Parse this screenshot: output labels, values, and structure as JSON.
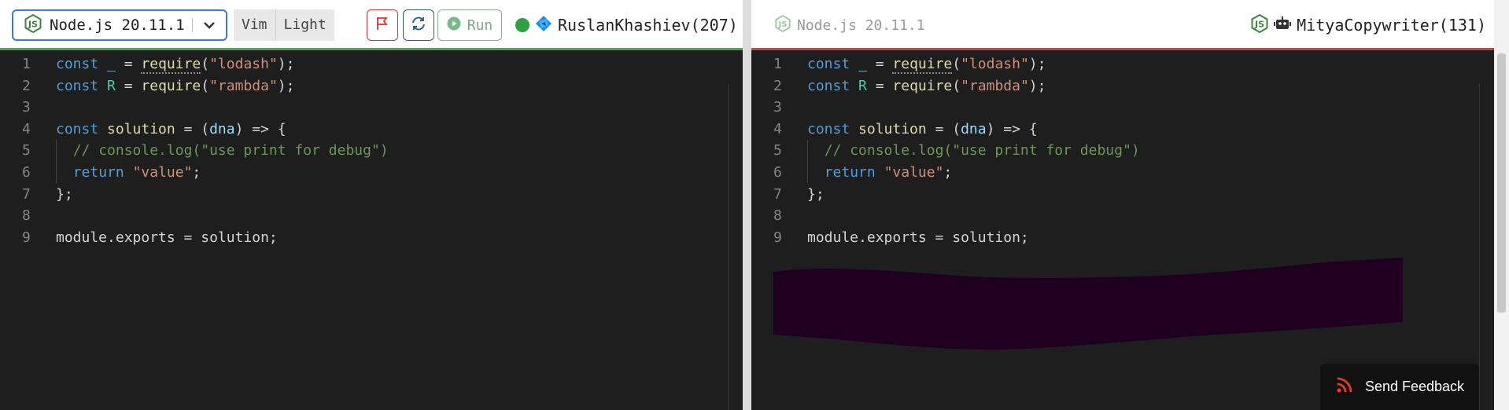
{
  "left": {
    "language_select": "Node.js 20.11.1",
    "mode_vim": "Vim",
    "mode_theme": "Light",
    "run_label": "Run",
    "player_name": "RuslanKhashiev(207)",
    "status_color": "#2ea043",
    "bar_color": "#3cb045"
  },
  "right": {
    "language": "Node.js 20.11.1",
    "player_name": "MityaCopywriter(131)",
    "bar_color": "#e03c3c"
  },
  "code_lines": [
    {
      "n": "1",
      "text": "const _ = require(\"lodash\");"
    },
    {
      "n": "2",
      "text": "const R = require(\"rambda\");"
    },
    {
      "n": "3",
      "text": ""
    },
    {
      "n": "4",
      "text": "const solution = (dna) => {"
    },
    {
      "n": "5",
      "text": "  // console.log(\"use print for debug\")"
    },
    {
      "n": "6",
      "text": "  return \"value\";"
    },
    {
      "n": "7",
      "text": "};"
    },
    {
      "n": "8",
      "text": ""
    },
    {
      "n": "9",
      "text": "module.exports = solution;"
    }
  ],
  "tokens": {
    "const": "const",
    "eq": " = ",
    "require": "require",
    "lodash": "\"lodash\"",
    "rambda": "\"rambda\"",
    "underscore": "_",
    "R": "R",
    "solution": "solution",
    "dna": "dna",
    "arrow_open": ") => {",
    "comment": "// console.log(\"use print for debug\")",
    "return": "return",
    "value": "\"value\"",
    "close": "};",
    "exports": "module.exports = solution;"
  },
  "feedback_button": "Send Feedback",
  "icons": {
    "lang": "nodejs-icon",
    "chevron": "chevron-down-icon",
    "flag": "flag-icon",
    "refresh": "refresh-icon",
    "run": "play-icon",
    "player_left": "user-avatar-icon",
    "player_right": "robot-icon",
    "feedback": "rss-icon"
  }
}
